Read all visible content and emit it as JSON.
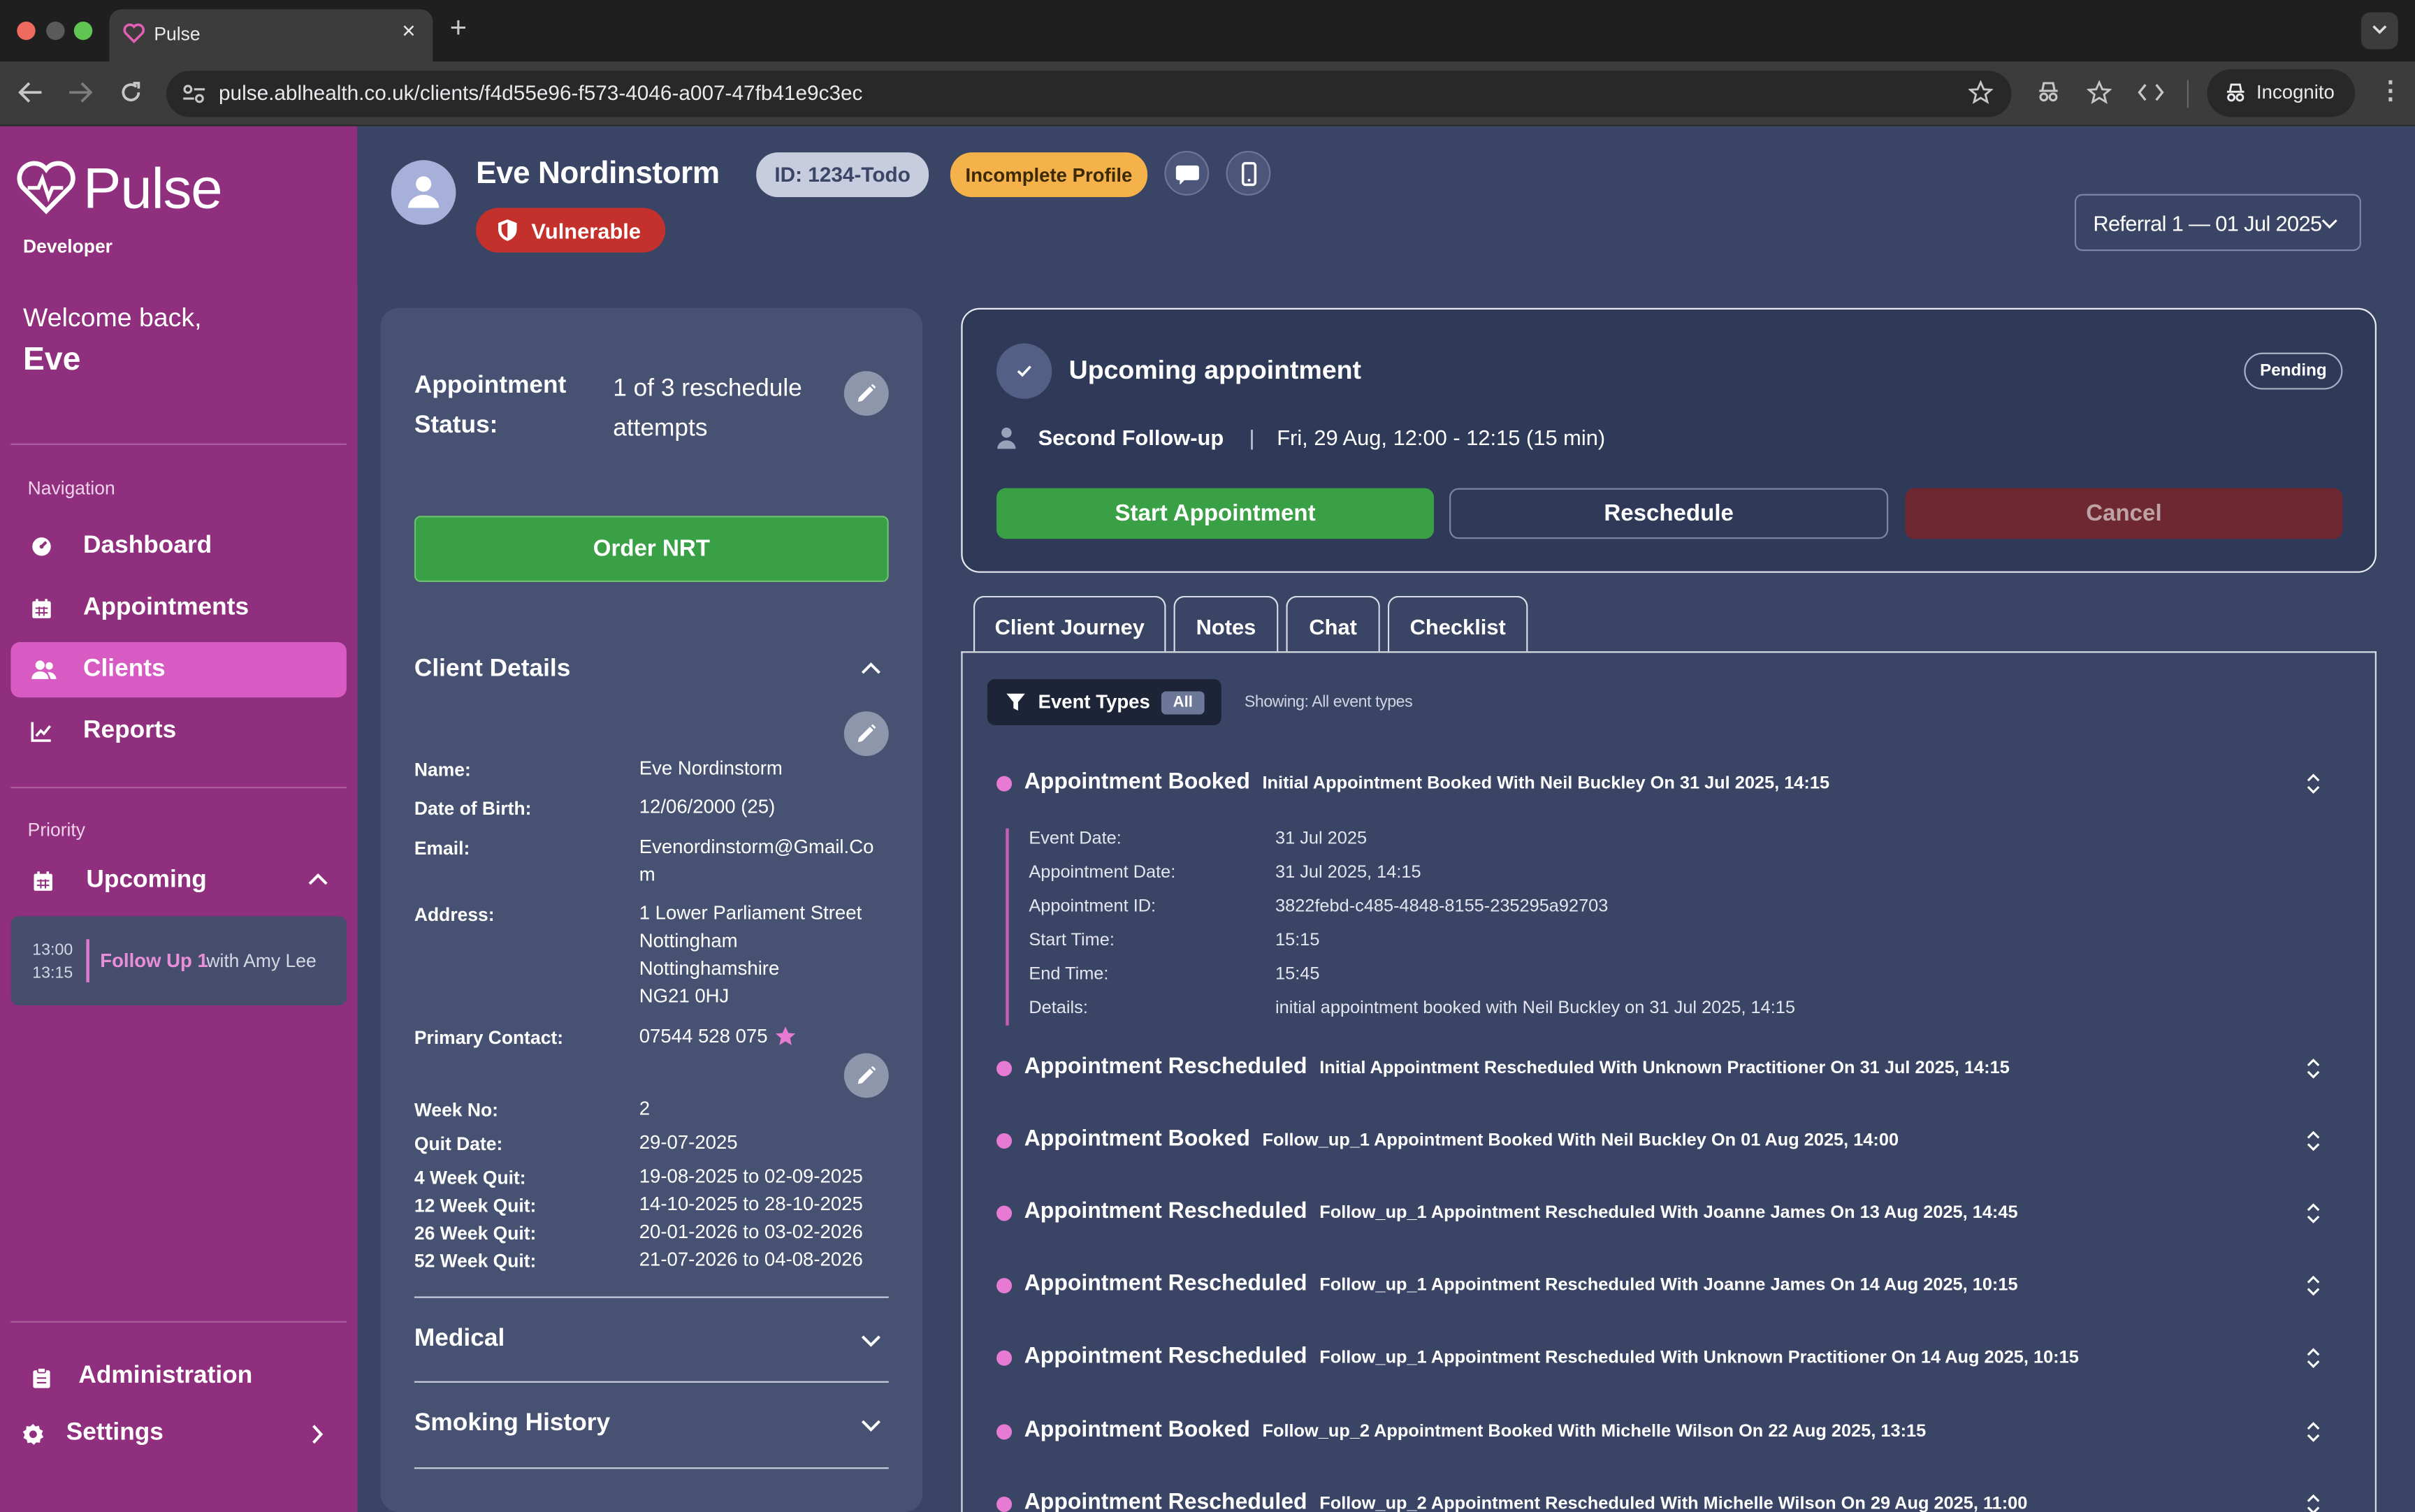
{
  "browser": {
    "tab_title": "Pulse",
    "url": "pulse.ablhealth.co.uk/clients/f4d55e96-f573-4046-a007-47fb41e9c3ec",
    "profile_label": "Incognito"
  },
  "sidebar": {
    "brand": "Pulse",
    "role": "Developer",
    "welcome": "Welcome back,",
    "user": "Eve",
    "nav_heading": "Navigation",
    "nav_items": [
      {
        "label": "Dashboard",
        "icon": "dashboard-icon"
      },
      {
        "label": "Appointments",
        "icon": "calendar-icon"
      },
      {
        "label": "Clients",
        "icon": "users-icon",
        "active": true
      },
      {
        "label": "Reports",
        "icon": "chart-icon"
      }
    ],
    "priority_heading": "Priority",
    "upcoming_label": "Upcoming",
    "upcoming_item": {
      "start": "13:00",
      "end": "13:15",
      "title": "Follow Up 1",
      "with": "with Amy Lee"
    },
    "admin_label": "Administration",
    "settings_label": "Settings"
  },
  "header": {
    "client_name": "Eve Nordinstorm",
    "client_id": "ID: 1234-Todo",
    "profile_badge": "Incomplete Profile",
    "vulnerable_badge": "Vulnerable",
    "referral_select": "Referral 1 — 01 Jul 2025"
  },
  "left_panel": {
    "status_label": "Appointment Status:",
    "status_label_1": "Appointment",
    "status_label_2": "Status:",
    "status_value_1": "1 of 3 reschedule",
    "status_value_2": "attempts",
    "order_button": "Order NRT",
    "client_details_title": "Client Details",
    "details": {
      "name_label": "Name:",
      "name": "Eve Nordinstorm",
      "dob_label": "Date of Birth:",
      "dob": "12/06/2000 (25)",
      "email_label": "Email:",
      "email_1": "Evenordinstorm@Gmail.Co",
      "email_2": "m",
      "address_label": "Address:",
      "address_1": "1 Lower Parliament Street",
      "address_2": "Nottingham",
      "address_3": "Nottinghamshire",
      "address_4": "NG21 0HJ",
      "contact_label": "Primary Contact:",
      "contact": "07544 528 075"
    },
    "quit": {
      "week_label": "Week No:",
      "week": "2",
      "quit_date_label": "Quit Date:",
      "quit_date": "29-07-2025",
      "w4_label": "4 Week Quit:",
      "w4": "19-08-2025 to 02-09-2025",
      "w12_label": "12 Week Quit:",
      "w12": "14-10-2025 to 28-10-2025",
      "w26_label": "26 Week Quit:",
      "w26": "20-01-2026 to 03-02-2026",
      "w52_label": "52 Week Quit:",
      "w52": "21-07-2026 to 04-08-2026"
    },
    "medical_title": "Medical",
    "smoking_title": "Smoking History"
  },
  "appointment": {
    "title": "Upcoming appointment",
    "status": "Pending",
    "type": "Second Follow-up",
    "separator": "|",
    "when": "Fri, 29 Aug, 12:00 - 12:15 (15 min)",
    "start_button": "Start Appointment",
    "reschedule_button": "Reschedule",
    "cancel_button": "Cancel"
  },
  "tabs": [
    "Client Journey",
    "Notes",
    "Chat",
    "Checklist"
  ],
  "journey": {
    "filter_label": "Event Types",
    "filter_badge": "All",
    "showing": "Showing: All event types",
    "expanded_details": [
      {
        "label": "Event Date:",
        "value": "31 Jul 2025"
      },
      {
        "label": "Appointment Date:",
        "value": "31 Jul 2025, 14:15"
      },
      {
        "label": "Appointment ID:",
        "value": "3822febd-c485-4848-8155-235295a92703"
      },
      {
        "label": "Start Time:",
        "value": "15:15"
      },
      {
        "label": "End Time:",
        "value": "15:45"
      },
      {
        "label": "Details:",
        "value": "initial appointment booked with Neil Buckley on 31 Jul 2025, 14:15"
      }
    ],
    "events": [
      {
        "type": "Appointment Booked",
        "desc": "Initial Appointment Booked With Neil Buckley On 31 Jul 2025, 14:15"
      },
      {
        "type": "Appointment Rescheduled",
        "desc": "Initial Appointment Rescheduled With Unknown Practitioner On 31 Jul 2025, 14:15"
      },
      {
        "type": "Appointment Booked",
        "desc": "Follow_up_1 Appointment Booked With Neil Buckley On 01 Aug 2025, 14:00"
      },
      {
        "type": "Appointment Rescheduled",
        "desc": "Follow_up_1 Appointment Rescheduled With Joanne James On 13 Aug 2025, 14:45"
      },
      {
        "type": "Appointment Rescheduled",
        "desc": "Follow_up_1 Appointment Rescheduled With Joanne James On 14 Aug 2025, 10:15"
      },
      {
        "type": "Appointment Rescheduled",
        "desc": "Follow_up_1 Appointment Rescheduled With Unknown Practitioner On 14 Aug 2025, 10:15"
      },
      {
        "type": "Appointment Booked",
        "desc": "Follow_up_2 Appointment Booked With Michelle Wilson On 22 Aug 2025, 13:15"
      },
      {
        "type": "Appointment Rescheduled",
        "desc": "Follow_up_2 Appointment Rescheduled With Michelle Wilson On 29 Aug 2025, 11:00"
      }
    ]
  },
  "colors": {
    "sidebar": "#8f2f7d",
    "active_nav": "#d85bc4",
    "main_bg": "#3a4565",
    "green": "#3aa045",
    "cancel": "#6e2832",
    "pending_badge": "#f6b24a",
    "vulnerable": "#c4302b",
    "bullet": "#e77ad2"
  }
}
